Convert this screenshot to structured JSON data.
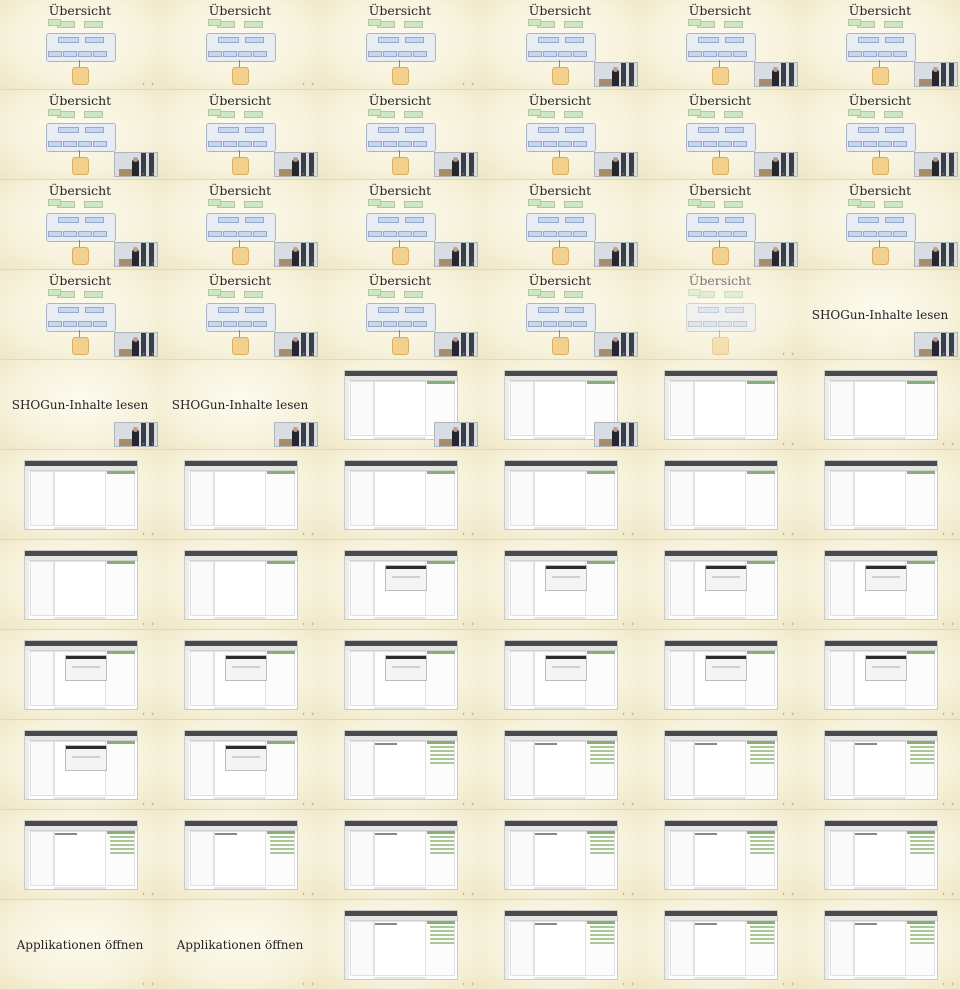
{
  "title_uebersicht": "Übersicht",
  "title_shogun": "SHOGun-Inhalte lesen",
  "title_apps": "Applikationen öffnen",
  "nav_arrows": "‹ ›",
  "colors": {
    "background": "#f3eed6",
    "green_box": "#cfe6c5",
    "blue_box": "#c9d7ec",
    "database": "#f4d08e"
  },
  "icons": [
    "navigation-arrows-icon",
    "speaker-video-thumbnail",
    "slide-diagram",
    "application-screenshot"
  ]
}
